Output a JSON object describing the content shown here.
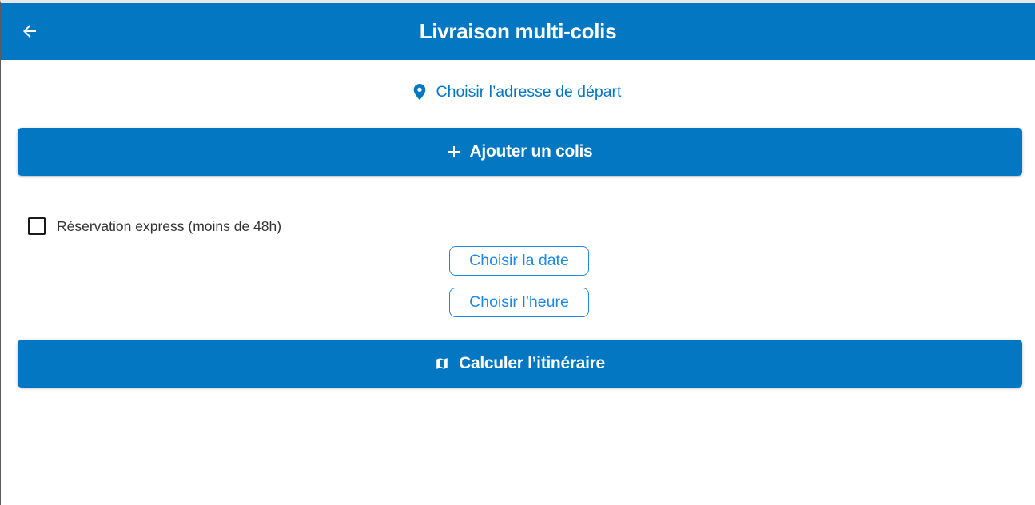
{
  "appbar": {
    "title": "Livraison multi-colis",
    "back_icon": "arrow-left-icon",
    "background": "#0477c2"
  },
  "departure": {
    "label": "Choisir l’adresse de départ",
    "icon": "map-pin-icon"
  },
  "add_parcel": {
    "label": "Ajouter un colis",
    "icon": "plus-icon"
  },
  "express": {
    "label": "Réservation express (moins de 48h)",
    "checked": false
  },
  "schedule": {
    "date_label": "Choisir la date",
    "time_label": "Choisir l’heure"
  },
  "calculate": {
    "label": "Calculer l’itinéraire",
    "icon": "map-icon"
  },
  "colors": {
    "primary": "#0477c2",
    "outline": "#1e88e5"
  }
}
